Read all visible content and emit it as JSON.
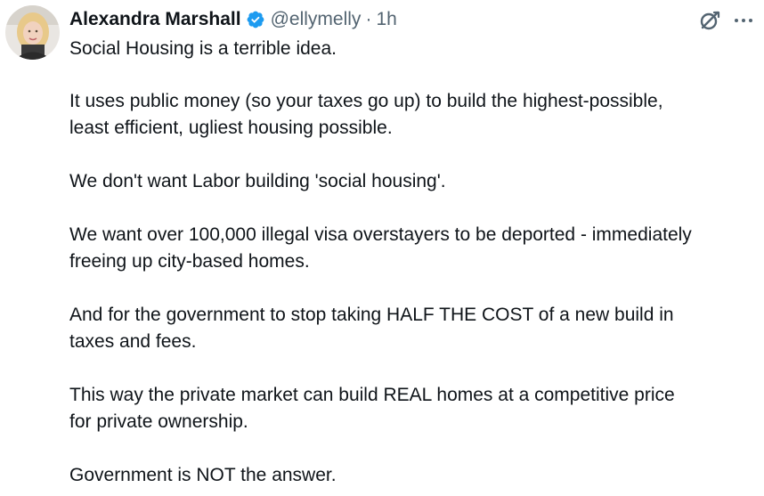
{
  "tweet": {
    "author": {
      "display_name": "Alexandra Marshall",
      "handle": "@ellymelly",
      "verified": true,
      "avatar_icon": "profile-photo"
    },
    "separator": "·",
    "timestamp": "1h",
    "actions": {
      "grok_icon": "grok-icon",
      "more_icon": "more-options-icon"
    },
    "paragraphs": [
      [
        "Social Housing is a terrible idea."
      ],
      [
        "It uses public money (so your taxes go up) to build the highest-possible,",
        "least efficient, ugliest housing possible."
      ],
      [
        "We don't want Labor building 'social housing'."
      ],
      [
        "We want over 100,000 illegal visa overstayers to be deported - immediately",
        "freeing up city-based homes."
      ],
      [
        "And for the government to stop taking HALF THE COST of a new build in",
        "taxes and fees."
      ],
      [
        "This way the private market can build REAL homes at a competitive price",
        "for private ownership."
      ],
      [
        "Government is NOT the answer."
      ]
    ]
  },
  "colors": {
    "text": "#0f1419",
    "secondary": "#536471",
    "verified_badge": "#1d9bf0"
  }
}
